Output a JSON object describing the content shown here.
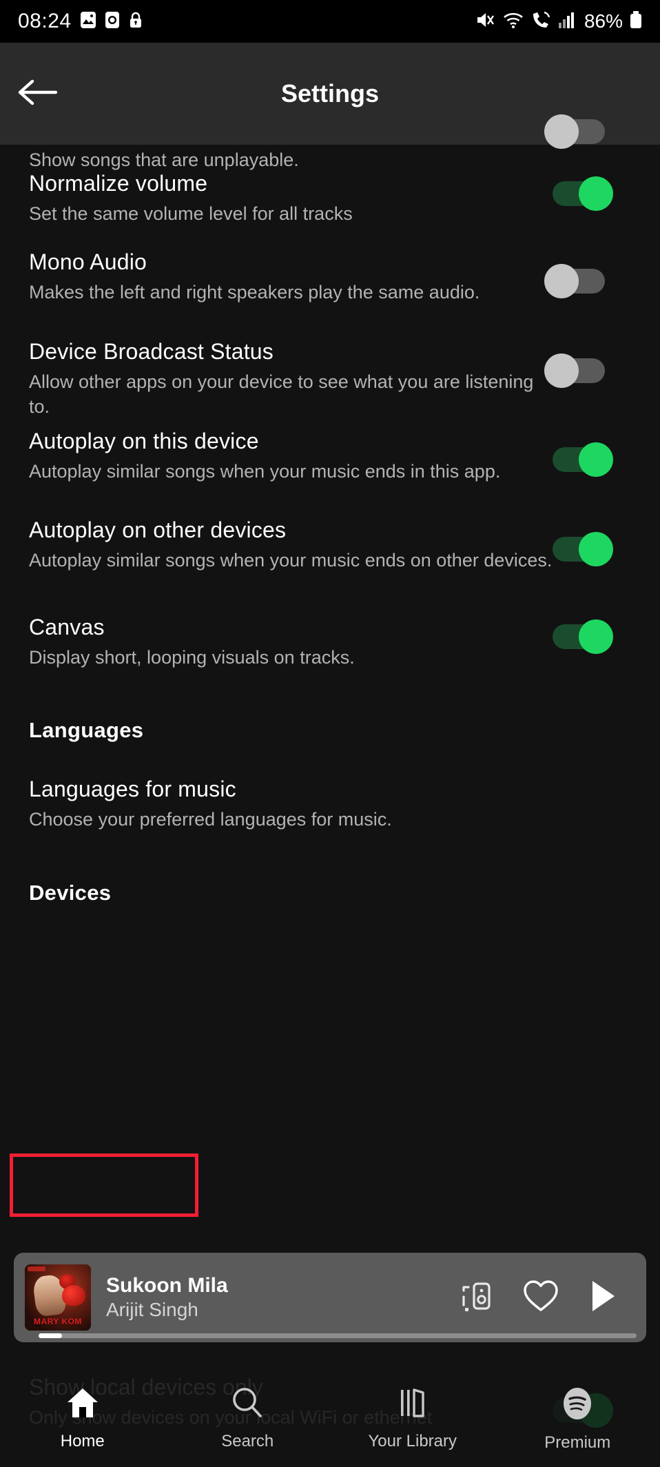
{
  "status_bar": {
    "time": "08:24",
    "battery_percent": "86%",
    "left_icons": [
      "image-icon",
      "alarm-icon",
      "lock-icon"
    ],
    "right_icons": [
      "mute-icon",
      "wifi-icon",
      "call-signal-icon",
      "cellular-signal-icon",
      "battery-icon"
    ]
  },
  "header": {
    "back_icon": "arrow-left-icon",
    "title": "Settings"
  },
  "settings": {
    "partial_row": {
      "subtitle": "Show songs that are unplayable.",
      "toggle": "off"
    },
    "items": [
      {
        "title": "Normalize volume",
        "subtitle": "Set the same volume level for all tracks",
        "toggle": "on"
      },
      {
        "title": "Mono Audio",
        "subtitle": "Makes the left and right speakers play the same audio.",
        "toggle": "off"
      },
      {
        "title": "Device Broadcast Status",
        "subtitle": "Allow other apps on your device to see what you are listening to.",
        "toggle": "off"
      },
      {
        "title": "Autoplay on this device",
        "subtitle": "Autoplay similar songs when your music ends in this app.",
        "toggle": "on"
      },
      {
        "title": "Autoplay on other devices",
        "subtitle": "Autoplay similar songs when your music ends on other devices.",
        "toggle": "on"
      },
      {
        "title": "Canvas",
        "subtitle": "Display short, looping visuals on tracks.",
        "toggle": "on"
      }
    ],
    "languages_section": {
      "heading": "Languages",
      "item_title": "Languages for music",
      "item_subtitle": "Choose your preferred languages for music."
    },
    "devices_section": {
      "heading": "Devices",
      "highlighted": true,
      "highlight_color": "#f01f33",
      "hidden_item_title": "Show local devices only",
      "hidden_item_subtitle": "Only show devices on your local WiFi or ethernet",
      "hidden_item_toggle": "on"
    }
  },
  "now_playing": {
    "album_art_text": "MARY KOM",
    "track": "Sukoon Mila",
    "artist": "Arijit Singh",
    "actions": [
      "connect-to-device-icon",
      "heart-icon",
      "play-icon"
    ],
    "progress_percent": 4
  },
  "bottom_nav": {
    "items": [
      {
        "label": "Home",
        "icon": "home-icon",
        "active": true
      },
      {
        "label": "Search",
        "icon": "search-icon",
        "active": false
      },
      {
        "label": "Your Library",
        "icon": "library-icon",
        "active": false
      },
      {
        "label": "Premium",
        "icon": "spotify-logo-icon",
        "active": false
      }
    ]
  },
  "theme": {
    "background": "#121212",
    "header_background": "#2b2b2b",
    "accent_green": "#1ed760",
    "toggle_on_track": "#1a4d2e",
    "toggle_off_track": "#5a5a5a",
    "toggle_off_thumb": "#c6c6c6",
    "secondary_text": "#b3b3b3",
    "now_playing_background": "#5b5b5b"
  }
}
